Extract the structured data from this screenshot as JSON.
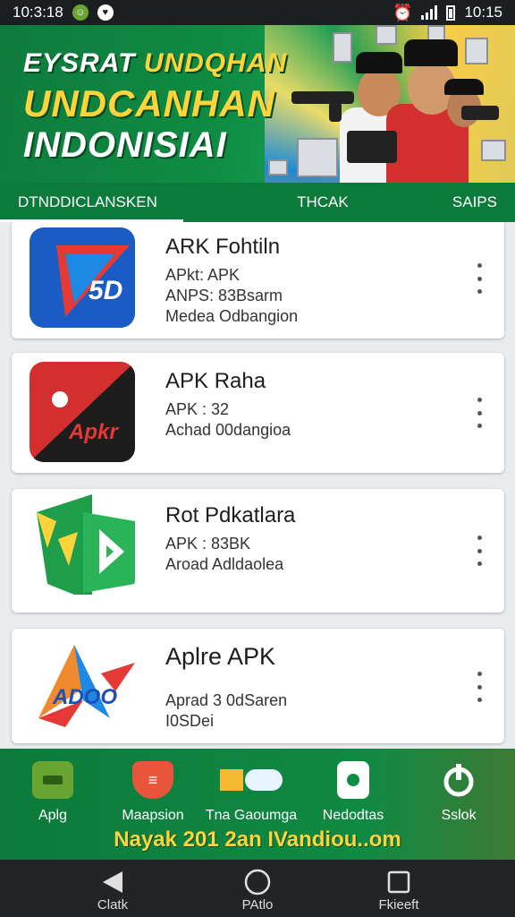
{
  "status_bar": {
    "time": "10:3:18",
    "right_time": "10:15",
    "icons": [
      "notification-icon",
      "chat-icon",
      "alarm-icon",
      "signal-icon",
      "battery-icon"
    ]
  },
  "banner": {
    "line1_a": "EYSRAT",
    "line1_b": "UNDQHAN",
    "line2": "UNDCANHAN",
    "line3": "INDONISIAI"
  },
  "tabs": [
    {
      "label": "DTNDDICLANSKEN",
      "active": true
    },
    {
      "label": "THCAK",
      "active": false
    },
    {
      "label": "SAIPS",
      "active": false
    }
  ],
  "apps": [
    {
      "title": "ARK Fohtiln",
      "lines": [
        "APkt: APK",
        "ANPS: 83Bsarm",
        "Medea Odbangion"
      ],
      "icon": "blue-arrow-app-icon"
    },
    {
      "title": "APK Raha",
      "lines": [
        "APK : 32",
        "Achad 00dangioa"
      ],
      "icon": "red-black-app-icon"
    },
    {
      "title": "Rot Pdkatlara",
      "lines": [
        "APK : 83BK",
        "Aroad Adldaolea"
      ],
      "icon": "green-play-app-icon"
    },
    {
      "title": "Aplre APK",
      "lines": [
        "Aprad 3 0dSaren",
        "I0SDei"
      ],
      "icon": "colorful-a-app-icon"
    }
  ],
  "bottom_bar": {
    "items": [
      {
        "label": "Aplg",
        "icon": "folder-icon"
      },
      {
        "label": "Maapsion",
        "icon": "shield-icon"
      },
      {
        "label": "Tna Gaoumga",
        "icon": "cloud-icon"
      },
      {
        "label": "Nedodtas",
        "icon": "camera-icon"
      },
      {
        "label": "Sslok",
        "icon": "power-icon"
      }
    ],
    "footer": "Nayak 201 2an IVandiou..om"
  },
  "nav_bar": {
    "back": "Clatk",
    "home": "PAtlo",
    "recents": "Fkieeft"
  },
  "colors": {
    "brand_green": "#0b7a3a",
    "accent_yellow": "#ffd43b",
    "status_bar": "#1c1f22"
  }
}
